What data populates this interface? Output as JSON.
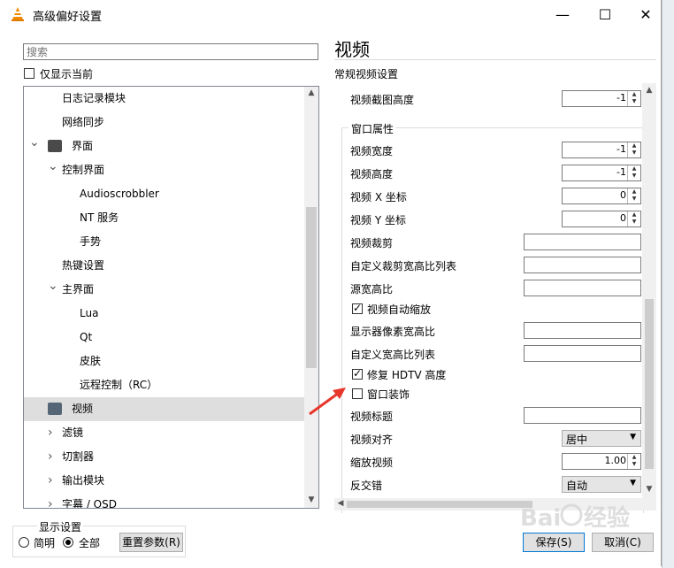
{
  "window": {
    "title": "高级偏好设置",
    "minimize_icon": "—",
    "maximize_icon": "☐",
    "close_icon": "✕"
  },
  "left": {
    "search_placeholder": "搜索",
    "show_current_label": "仅显示当前",
    "show_current_checked": false,
    "tree": [
      {
        "label": "日志记录模块",
        "level": 1
      },
      {
        "label": "网络同步",
        "level": 1
      },
      {
        "label": "界面",
        "level": 0,
        "expanded": true,
        "icon": "interface-icon"
      },
      {
        "label": "控制界面",
        "level": 1,
        "expanded": true
      },
      {
        "label": "Audioscrobbler",
        "level": 2
      },
      {
        "label": "NT 服务",
        "level": 2
      },
      {
        "label": "手势",
        "level": 2
      },
      {
        "label": "热键设置",
        "level": 1
      },
      {
        "label": "主界面",
        "level": 1,
        "expanded": true
      },
      {
        "label": "Lua",
        "level": 2
      },
      {
        "label": "Qt",
        "level": 2
      },
      {
        "label": "皮肤",
        "level": 2
      },
      {
        "label": "远程控制（RC）",
        "level": 2
      },
      {
        "label": "视频",
        "level": 0,
        "selected": true,
        "icon": "video-icon"
      },
      {
        "label": "滤镜",
        "level": 1,
        "collapsed": true
      },
      {
        "label": "切割器",
        "level": 1,
        "collapsed": true
      },
      {
        "label": "输出模块",
        "level": 1,
        "collapsed": true
      },
      {
        "label": "字幕 / OSD",
        "level": 1,
        "collapsed": true
      }
    ]
  },
  "right": {
    "heading": "视频",
    "section": "常规视频设置",
    "snapshot_height_label": "视频截图高度",
    "snapshot_height_value": "-1",
    "group_title": "窗口属性",
    "fields": {
      "width": {
        "label": "视频宽度",
        "value": "-1"
      },
      "height": {
        "label": "视频高度",
        "value": "-1"
      },
      "x": {
        "label": "视频 X 坐标",
        "value": "0"
      },
      "y": {
        "label": "视频 Y 坐标",
        "value": "0"
      },
      "crop": {
        "label": "视频裁剪",
        "value": ""
      },
      "custom_crop": {
        "label": "自定义裁剪宽高比列表",
        "value": ""
      },
      "source_ar": {
        "label": "源宽高比",
        "value": ""
      },
      "autoscale": {
        "label": "视频自动缩放",
        "checked": true
      },
      "monitor_ar": {
        "label": "显示器像素宽高比",
        "value": ""
      },
      "custom_ar": {
        "label": "自定义宽高比列表",
        "value": ""
      },
      "hdtv_fix": {
        "label": "修复 HDTV 高度",
        "checked": true
      },
      "decorations": {
        "label": "窗口装饰",
        "checked": false
      },
      "video_title": {
        "label": "视频标题",
        "value": ""
      },
      "align": {
        "label": "视频对齐",
        "value": "居中"
      },
      "zoom": {
        "label": "缩放视频",
        "value": "1.00"
      },
      "deinterlace": {
        "label": "反交错",
        "value": "自动"
      }
    }
  },
  "footer": {
    "display_settings_label": "显示设置",
    "simple_label": "简明",
    "all_label": "全部",
    "simple_selected": false,
    "all_selected": true,
    "reset_label": "重置参数(R)",
    "save_label": "保存(S)",
    "cancel_label": "取消(C)"
  },
  "annotation": {
    "arrow_color": "#e8362b"
  },
  "watermark": "Baidu 经验"
}
